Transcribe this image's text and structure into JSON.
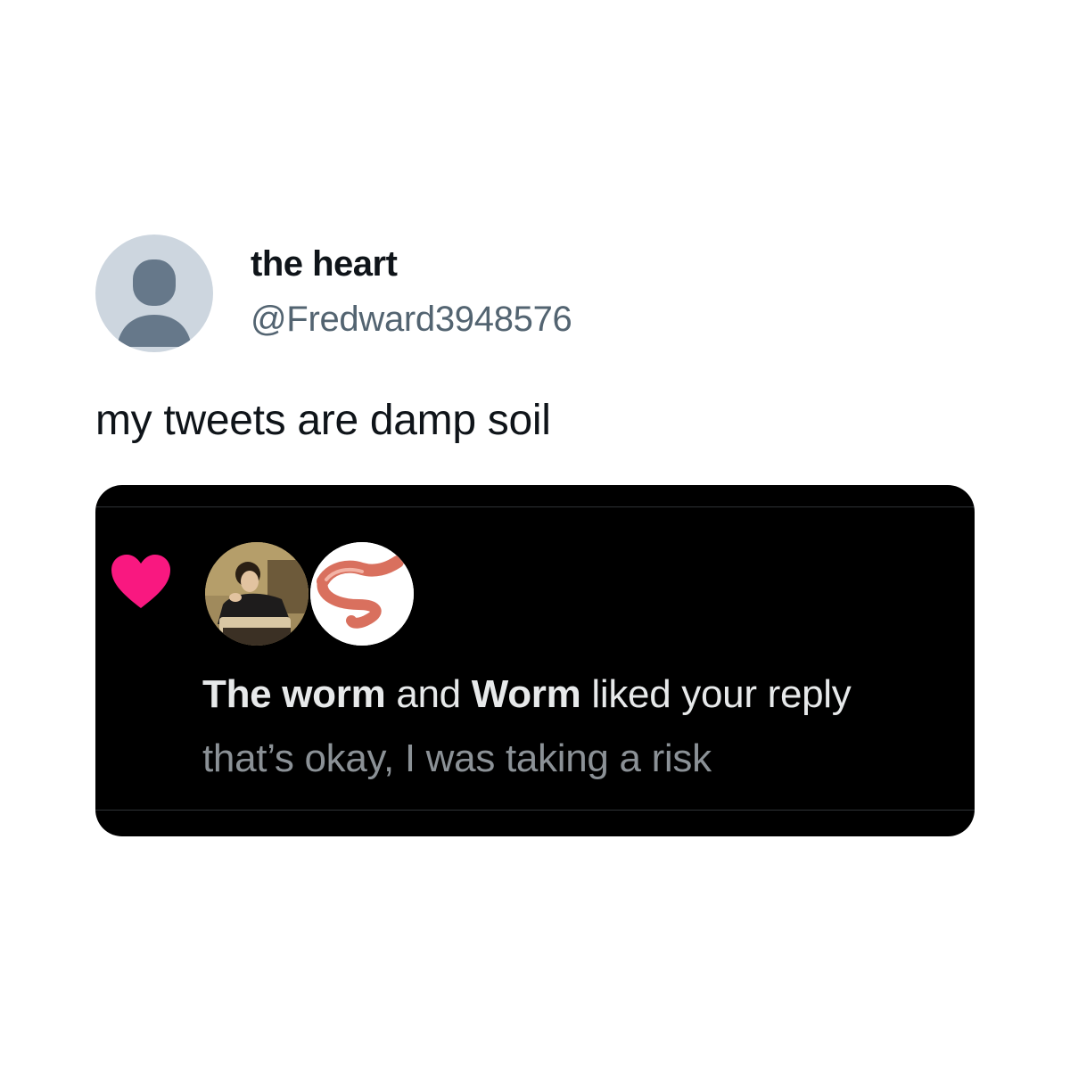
{
  "tweet": {
    "author": {
      "display_name": "the heart",
      "handle": "@Fredward3948576",
      "avatar_icon": "default-profile-icon"
    },
    "text": "my tweets are damp soil"
  },
  "notification": {
    "type_icon": "heart-icon",
    "heart_color": "#f91880",
    "likers": [
      {
        "name": "The worm",
        "avatar_icon": "painting-portrait-avatar"
      },
      {
        "name": "Worm",
        "avatar_icon": "worm-avatar"
      }
    ],
    "connector": " and ",
    "action": " liked your reply",
    "reply_text": "that’s okay, I was taking a risk"
  },
  "colors": {
    "card_background": "#000000",
    "name_text": "#0f1419",
    "handle_text": "#536471"
  }
}
